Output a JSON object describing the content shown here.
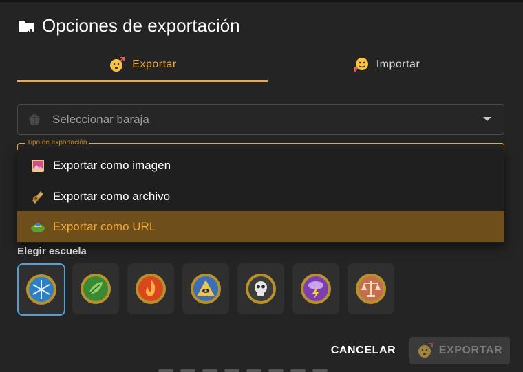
{
  "dialog": {
    "title": "Opciones de exportación",
    "title_icon": "folder-share-icon"
  },
  "tabs": [
    {
      "label": "Exportar",
      "icon": "export-emoji-icon",
      "active": true
    },
    {
      "label": "Importar",
      "icon": "import-emoji-icon",
      "active": false
    }
  ],
  "deck_select": {
    "placeholder": "Seleccionar baraja",
    "icon": "deck-gem-icon"
  },
  "export_type": {
    "label": "Tipo de exportación",
    "options": [
      {
        "label": "Exportar como imagen",
        "icon": "image-scroll-icon",
        "selected": false
      },
      {
        "label": "Exportar como archivo",
        "icon": "file-scroll-icon",
        "selected": false
      },
      {
        "label": "Exportar como URL",
        "icon": "url-stamp-icon",
        "selected": true
      }
    ]
  },
  "schools": {
    "label": "Elegir escuela",
    "items": [
      {
        "name": "ice",
        "icon": "ice-school-icon",
        "selected": true
      },
      {
        "name": "life",
        "icon": "life-school-icon",
        "selected": false
      },
      {
        "name": "fire",
        "icon": "fire-school-icon",
        "selected": false
      },
      {
        "name": "myth",
        "icon": "myth-school-icon",
        "selected": false
      },
      {
        "name": "death",
        "icon": "death-school-icon",
        "selected": false
      },
      {
        "name": "storm",
        "icon": "storm-school-icon",
        "selected": false
      },
      {
        "name": "balance",
        "icon": "balance-school-icon",
        "selected": false
      }
    ]
  },
  "actions": {
    "cancel_label": "CANCELAR",
    "export_label": "EXPORTAR",
    "export_disabled": true
  },
  "colors": {
    "accent": "#f3a838",
    "selected_bg": "#6e4f1c",
    "selected_school_border": "#4aa3e0",
    "background": "#242424"
  }
}
